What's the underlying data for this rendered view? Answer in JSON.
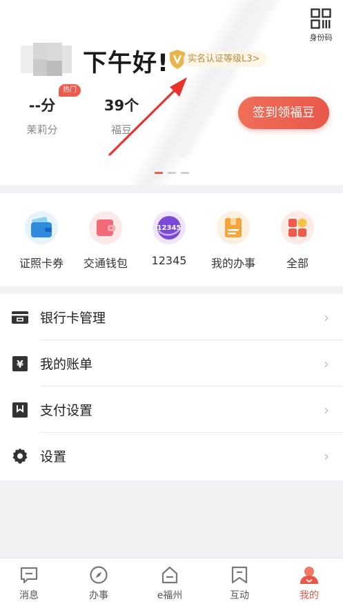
{
  "header": {
    "qr_label": "身份码",
    "greeting": "下午好!",
    "verify_badge": "实名认证等级L3>",
    "checkin_button": "签到领福豆"
  },
  "stats": [
    {
      "value": "--分",
      "label": "茉莉分",
      "tag": "热门"
    },
    {
      "value": "39个",
      "label": "福豆"
    }
  ],
  "carousel": {
    "pages": 3,
    "active": 0
  },
  "services": [
    {
      "label": "证照卡券",
      "icon": "wallet-card-icon"
    },
    {
      "label": "交通钱包",
      "icon": "transit-wallet-icon"
    },
    {
      "label": "12345",
      "icon": "hotline-12345-icon",
      "icon_text": "12345"
    },
    {
      "label": "我的办事",
      "icon": "my-affairs-icon"
    },
    {
      "label": "全部",
      "icon": "all-apps-icon"
    }
  ],
  "menu": [
    {
      "label": "银行卡管理",
      "icon": "bank-card-icon"
    },
    {
      "label": "我的账单",
      "icon": "bill-icon",
      "icon_text": "¥"
    },
    {
      "label": "支付设置",
      "icon": "payment-settings-icon"
    },
    {
      "label": "设置",
      "icon": "gear-icon"
    }
  ],
  "tabs": [
    {
      "label": "消息",
      "icon": "message-icon"
    },
    {
      "label": "办事",
      "icon": "compass-icon"
    },
    {
      "label": "e福州",
      "icon": "home-icon"
    },
    {
      "label": "互动",
      "icon": "interaction-icon"
    },
    {
      "label": "我的",
      "icon": "profile-icon",
      "active": true
    }
  ],
  "colors": {
    "accent": "#e8574a",
    "badge_text": "#b78a3f",
    "background": "#f2f2f4"
  }
}
